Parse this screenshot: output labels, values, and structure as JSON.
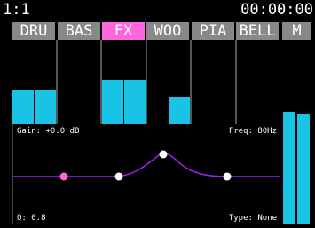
{
  "header": {
    "position": "1:1",
    "time": "00:00:00"
  },
  "tracks": [
    {
      "label": "DRU",
      "levels": [
        0.41,
        0.41
      ],
      "selected": false
    },
    {
      "label": "BAS",
      "levels": [
        0,
        0
      ],
      "selected": false
    },
    {
      "label": "FX",
      "levels": [
        0.53,
        0.53
      ],
      "selected": true
    },
    {
      "label": "WOO",
      "levels": [
        0,
        0.33
      ],
      "selected": false
    },
    {
      "label": "PIA",
      "levels": [
        0,
        0
      ],
      "selected": false
    },
    {
      "label": "BELL",
      "levels": [
        0,
        0
      ],
      "selected": false
    }
  ],
  "master": {
    "label": "M",
    "levels": [
      0.61,
      0.6
    ]
  },
  "eq": {
    "gain_label": "Gain: +0.0 dB",
    "freq_label": "Freq: 80Hz",
    "q_label": "Q: 0.8",
    "type_label": "Type: None",
    "bands": [
      {
        "name": "band-1",
        "selected": true
      },
      {
        "name": "band-2",
        "selected": false
      },
      {
        "name": "band-3",
        "selected": false
      },
      {
        "name": "band-4",
        "selected": false
      }
    ]
  },
  "colors": {
    "background": "#000000",
    "tab_bg": "#888888",
    "tab_selected_bg": "#ff66dd",
    "meter": "#19c3e6",
    "curve": "#a020f0",
    "selected_point": "#ff66dd",
    "point": "#ffffff"
  }
}
